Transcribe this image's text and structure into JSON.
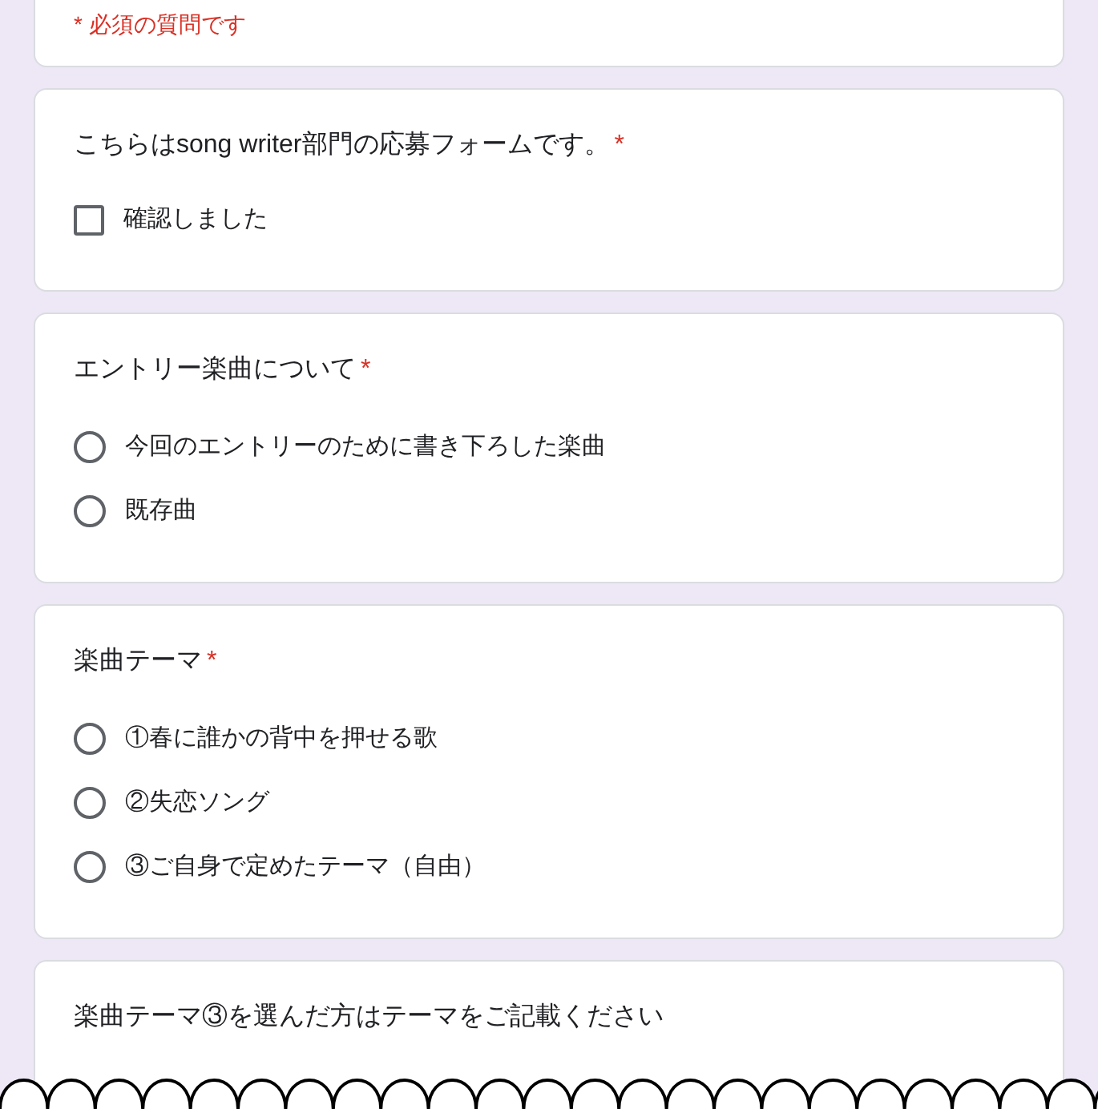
{
  "required_note": "* 必須の質問です",
  "questions": [
    {
      "kind": "checkbox",
      "title": "こちらはsong writer部門の応募フォームです。",
      "required_mark": "*",
      "options": [
        {
          "label": "確認しました",
          "checked": false
        }
      ]
    },
    {
      "kind": "radio",
      "title": "エントリー楽曲について",
      "required_mark": "*",
      "options": [
        {
          "label": "今回のエントリーのために書き下ろした楽曲",
          "selected": false
        },
        {
          "label": "既存曲",
          "selected": false
        }
      ]
    },
    {
      "kind": "radio",
      "title": "楽曲テーマ",
      "required_mark": "*",
      "options": [
        {
          "label": "①春に誰かの背中を押せる歌",
          "selected": false
        },
        {
          "label": "②失恋ソング",
          "selected": false
        },
        {
          "label": "③ご自身で定めたテーマ（自由）",
          "selected": false
        }
      ]
    },
    {
      "kind": "text",
      "title": "楽曲テーマ③を選んだ方はテーマをご記載ください"
    }
  ]
}
